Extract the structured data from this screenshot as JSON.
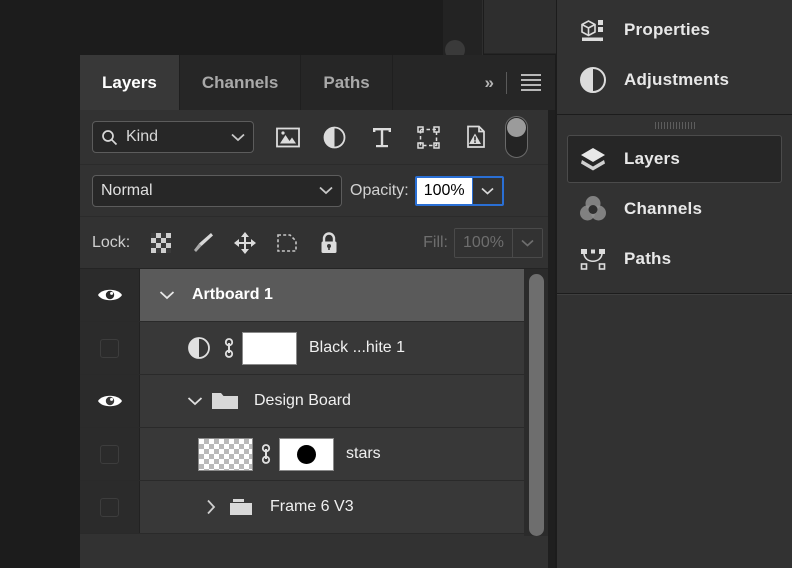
{
  "app": {
    "theme_bg": "#1c1c1c",
    "panel_bg": "#323232",
    "accent": "#2a6fd4",
    "selection_bg": "#5a5a5a"
  },
  "panel": {
    "tabs": [
      {
        "label": "Layers",
        "active": true,
        "icon": "layers-icon"
      },
      {
        "label": "Channels",
        "active": false,
        "icon": "channels-icon"
      },
      {
        "label": "Paths",
        "active": false,
        "icon": "paths-icon"
      }
    ],
    "overflow_label": "»",
    "menu_icon": "hamburger-menu-icon"
  },
  "filter": {
    "kind_label": "Kind",
    "search_icon": "search-icon",
    "chevron_icon": "chevron-down-icon",
    "filter_icons": [
      "image-filter-icon",
      "adjustment-filter-icon",
      "type-filter-icon",
      "shape-filter-icon",
      "smart-object-filter-icon"
    ],
    "toggle_name": "filter-enable-toggle",
    "toggle_on": false
  },
  "blend": {
    "mode": "Normal",
    "opacity_label": "Opacity:",
    "opacity_value": "100%",
    "opacity_focused": true
  },
  "lock": {
    "label": "Lock:",
    "icons": [
      "lock-transparency-icon",
      "lock-pixels-icon",
      "lock-position-icon",
      "lock-artboard-nesting-icon",
      "lock-all-icon"
    ],
    "fill_label": "Fill:",
    "fill_value": "100%",
    "fill_disabled": true
  },
  "layers": [
    {
      "name": "Artboard 1",
      "visible": true,
      "selected": true,
      "indent": 0,
      "twisty": "chevron-down-icon",
      "kind": "artboard",
      "thumb": "none"
    },
    {
      "name": "Black ...hite 1",
      "visible": false,
      "selected": false,
      "indent": 1,
      "twisty": "none",
      "kind": "adjustment",
      "thumb": "white-mask",
      "linked": true
    },
    {
      "name": "Design Board",
      "visible": true,
      "selected": false,
      "indent": 1,
      "twisty": "chevron-down-icon",
      "kind": "group-open",
      "thumb": "folder"
    },
    {
      "name": "stars",
      "visible": false,
      "selected": false,
      "indent": 2,
      "twisty": "none",
      "kind": "pixel",
      "thumb": "checker",
      "linked": true,
      "mask": "black-circle"
    },
    {
      "name": "Frame 6 V3",
      "visible": false,
      "selected": false,
      "indent": 2,
      "twisty": "chevron-right-icon",
      "kind": "group-closed",
      "thumb": "folder-closed"
    }
  ],
  "scrollbar": {
    "name": "layers-scrollbar",
    "orientation": "vertical"
  },
  "dock": {
    "groups": [
      {
        "items": [
          {
            "label": "Properties",
            "icon": "properties-icon",
            "selected": false
          },
          {
            "label": "Adjustments",
            "icon": "adjustments-icon",
            "selected": false
          }
        ]
      },
      {
        "handle": "panel-drag-handle",
        "items": [
          {
            "label": "Layers",
            "icon": "layers-icon",
            "selected": true
          },
          {
            "label": "Channels",
            "icon": "channels-icon",
            "selected": false
          },
          {
            "label": "Paths",
            "icon": "paths-icon",
            "selected": false
          }
        ]
      }
    ]
  }
}
